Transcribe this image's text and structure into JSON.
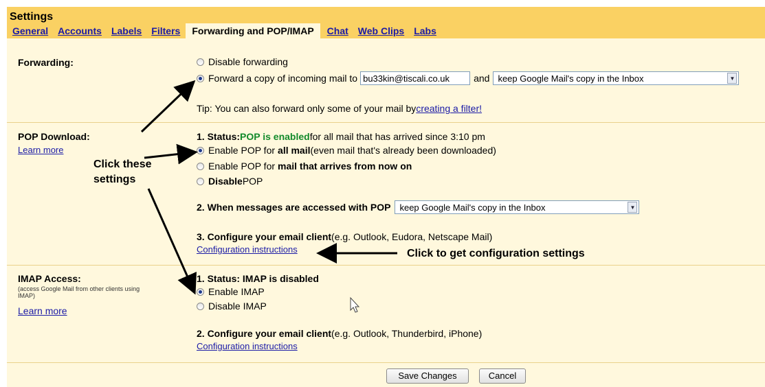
{
  "header": {
    "title": "Settings",
    "tabs": [
      "General",
      "Accounts",
      "Labels",
      "Filters",
      "Forwarding and POP/IMAP",
      "Chat",
      "Web Clips",
      "Labs"
    ],
    "active_tab": "Forwarding and POP/IMAP"
  },
  "forwarding": {
    "label": "Forwarding:",
    "disable_label": "Disable forwarding",
    "forward_label": "Forward a copy of incoming mail to",
    "email_value": "bu33kin@tiscali.co.uk",
    "and_label": "and",
    "action_value": "keep Google Mail's copy in the Inbox",
    "tip_prefix": "Tip: You can also forward only some of your mail by ",
    "tip_link": "creating a filter!"
  },
  "pop": {
    "label": "POP Download:",
    "learn_more": "Learn more",
    "status_prefix": "1. Status: ",
    "status_value": "POP is enabled",
    "status_suffix": " for all mail that has arrived since 3:10 pm",
    "option1_prefix": "Enable POP for ",
    "option1_bold": "all mail",
    "option1_suffix": " (even mail that's already been downloaded)",
    "option2_prefix": "Enable POP for ",
    "option2_bold": "mail that arrives from now on",
    "option3_bold": "Disable",
    "option3_suffix": " POP",
    "access_label": "2. When messages are accessed with POP",
    "access_value": "keep Google Mail's copy in the Inbox",
    "config_label": "3. Configure your email client",
    "config_hint": " (e.g. Outlook, Eudora, Netscape Mail)",
    "config_link": "Configuration instructions"
  },
  "imap": {
    "label": "IMAP Access:",
    "sublabel": "(access Google Mail from other clients using IMAP)",
    "learn_more": "Learn more",
    "status": "1. Status: IMAP is disabled",
    "enable_label": "Enable IMAP",
    "disable_label": "Disable IMAP",
    "config_label": "2. Configure your email client",
    "config_hint": " (e.g. Outlook, Thunderbird, iPhone)",
    "config_link": "Configuration instructions"
  },
  "buttons": {
    "save": "Save Changes",
    "cancel": "Cancel"
  },
  "annotations": {
    "click_these_line1": "Click these",
    "click_these_line2": "settings",
    "click_config": "Click to get configuration settings"
  },
  "colors": {
    "header_bg": "#fad163",
    "panel_bg": "#fff8dd",
    "link": "#1a1aa6",
    "status_green": "#128a2b"
  }
}
